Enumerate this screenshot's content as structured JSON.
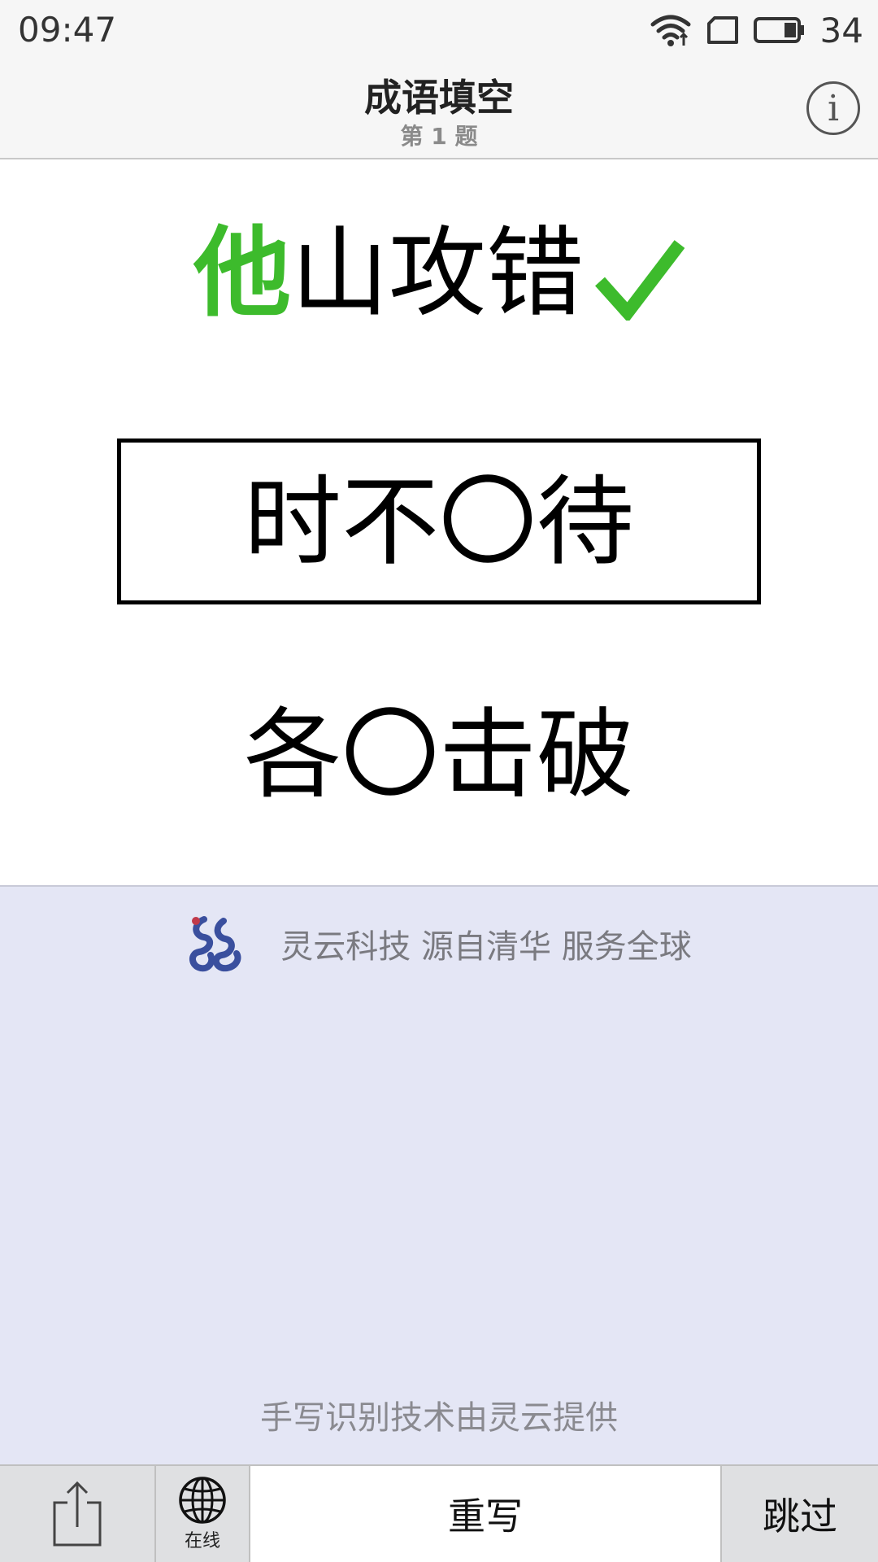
{
  "status_bar": {
    "time": "09:47",
    "battery_percent": "34"
  },
  "header": {
    "title": "成语填空",
    "subtitle": "第 1 题"
  },
  "puzzles": [
    {
      "filled_char": "他",
      "rest": "山攻错",
      "state": "correct"
    },
    {
      "text": "时不〇待",
      "state": "active"
    },
    {
      "text": "各〇击破",
      "state": "pending"
    }
  ],
  "handwriting_area": {
    "slogan": "灵云科技 源自清华 服务全球",
    "credit": "手写识别技术由灵云提供"
  },
  "toolbar": {
    "online_label": "在线",
    "rewrite_label": "重写",
    "skip_label": "跳过"
  },
  "colors": {
    "correct_green": "#3dbb2c",
    "handwrite_bg": "#e4e6f5",
    "toolbar_bg": "#dfe0e2"
  }
}
